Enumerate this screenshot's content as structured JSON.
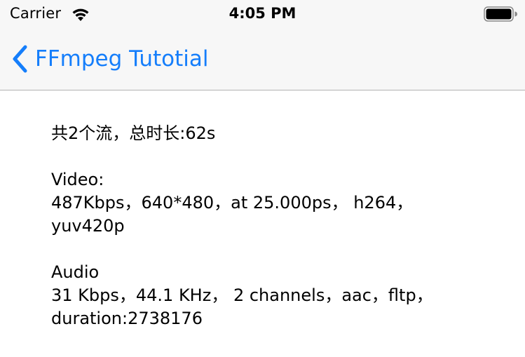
{
  "status_bar": {
    "carrier": "Carrier",
    "time": "4:05 PM"
  },
  "nav_bar": {
    "back_label": "FFmpeg Tutotial",
    "accent_color": "#157efb"
  },
  "info": {
    "summary": "共2个流，总时长:62s",
    "video_title": "Video:",
    "video_line1": "487Kbps，640*480，at 25.000ps， h264，",
    "video_line2": "yuv420p",
    "audio_title": "Audio",
    "audio_line1": "31 Kbps，44.1 KHz， 2 channels，aac，fltp，",
    "audio_line2": "duration:2738176"
  }
}
